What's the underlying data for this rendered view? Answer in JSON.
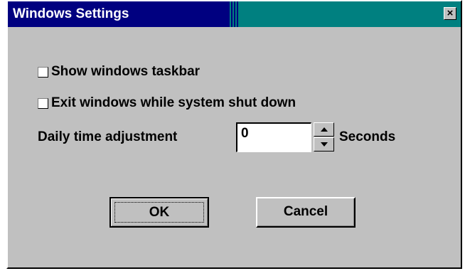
{
  "window": {
    "title": "Windows Settings",
    "close_glyph": "×",
    "close_icon": "close-icon",
    "colors": {
      "title_left": "#000080",
      "title_right": "#008080",
      "face": "#c0c0c0"
    }
  },
  "options": {
    "show_taskbar": {
      "label": "Show windows taskbar",
      "checked": false
    },
    "exit_on_shutdown": {
      "label": "Exit windows while system shut down",
      "checked": false
    }
  },
  "daily_adjustment": {
    "label": "Daily time adjustment",
    "value": "0",
    "unit": "Seconds",
    "up_icon": "spin-up-icon",
    "down_icon": "spin-down-icon"
  },
  "buttons": {
    "ok": "OK",
    "cancel": "Cancel"
  }
}
